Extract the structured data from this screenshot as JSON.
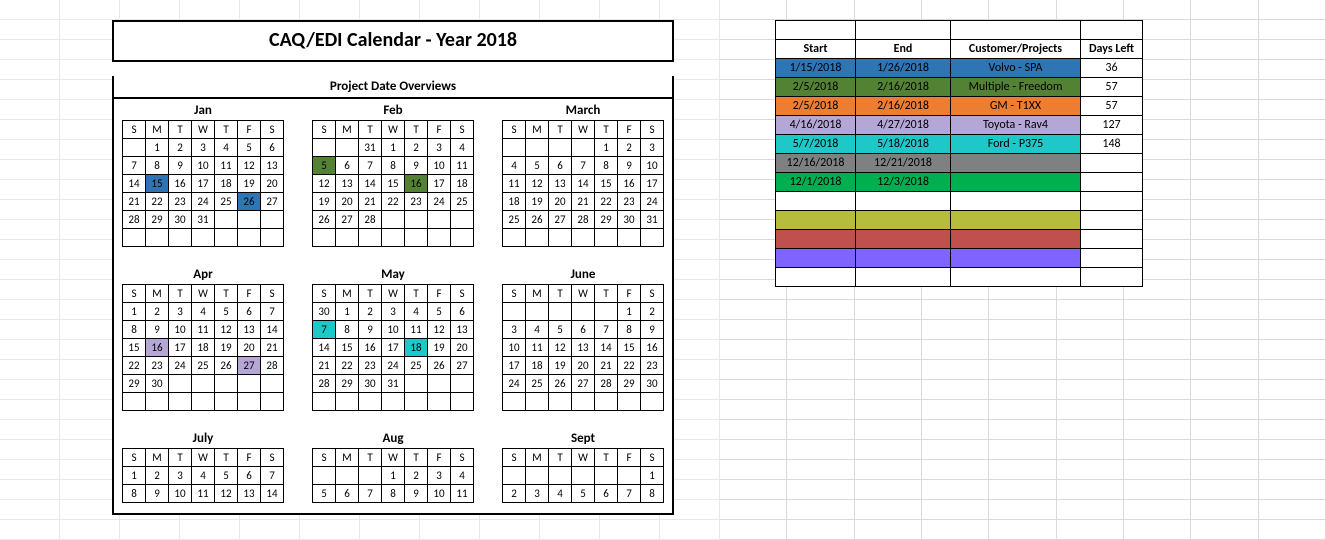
{
  "title": "CAQ/EDI Calendar - Year 2018",
  "subtitle": "Project Date Overviews",
  "dow": [
    "S",
    "M",
    "T",
    "W",
    "T",
    "F",
    "S"
  ],
  "months": [
    {
      "name": "Jan",
      "lead": 1,
      "days": 31,
      "hl": {
        "15": "#2e75b6",
        "26": "#2e75b6"
      }
    },
    {
      "name": "Feb",
      "lead": 3,
      "pre": [
        31
      ],
      "days": 28,
      "hl": {
        "5": "#548235",
        "16": "#548235"
      }
    },
    {
      "name": "March",
      "lead": 4,
      "days": 31,
      "hl": {}
    },
    {
      "name": "Apr",
      "lead": 0,
      "days": 30,
      "hl": {
        "16": "#b6a6d6",
        "27": "#b6a6d6"
      }
    },
    {
      "name": "May",
      "lead": 1,
      "pre": [
        30
      ],
      "days": 31,
      "hl": {
        "7": "#1ec8c8",
        "18": "#1ec8c8"
      }
    },
    {
      "name": "June",
      "lead": 5,
      "days": 30,
      "hl": {}
    },
    {
      "name": "July",
      "lead": 0,
      "days": 14,
      "hl": {}
    },
    {
      "name": "Aug",
      "lead": 3,
      "days": 11,
      "hl": {}
    },
    {
      "name": "Sept",
      "lead": 6,
      "days": 8,
      "hl": {}
    }
  ],
  "proj_headers": [
    "Start",
    "End",
    "Customer/Projects",
    "Days Left"
  ],
  "projects": [
    {
      "start": "1/15/2018",
      "end": "1/26/2018",
      "cust": "Volvo - SPA",
      "days": "36",
      "bg": "#2e75b6",
      "bg2": "#2e75b6",
      "bg3": "#2e75b6"
    },
    {
      "start": "2/5/2018",
      "end": "2/16/2018",
      "cust": "Multiple - Freedom",
      "days": "57",
      "bg": "#548235",
      "bg2": "#548235",
      "bg3": "#548235"
    },
    {
      "start": "2/5/2018",
      "end": "2/16/2018",
      "cust": "GM - T1XX",
      "days": "57",
      "bg": "#ed7d31",
      "bg2": "#ed7d31",
      "bg3": "#ed7d31"
    },
    {
      "start": "4/16/2018",
      "end": "4/27/2018",
      "cust": "Toyota - Rav4",
      "days": "127",
      "bg": "#b6a6d6",
      "bg2": "#b6a6d6",
      "bg3": "#b6a6d6"
    },
    {
      "start": "5/7/2018",
      "end": "5/18/2018",
      "cust": "Ford - P375",
      "days": "148",
      "bg": "#1ec8c8",
      "bg2": "#1ec8c8",
      "bg3": "#1ec8c8"
    },
    {
      "start": "12/16/2018",
      "end": "12/21/2018",
      "cust": "",
      "days": "",
      "bg": "#808080",
      "bg2": "#808080",
      "bg3": "#808080"
    },
    {
      "start": "12/1/2018",
      "end": "12/3/2018",
      "cust": "",
      "days": "",
      "bg": "#00b050",
      "bg2": "#00b050",
      "bg3": "#00b050"
    },
    {
      "start": "",
      "end": "",
      "cust": "",
      "days": "",
      "bg": "",
      "bg2": "",
      "bg3": ""
    },
    {
      "start": "",
      "end": "",
      "cust": "",
      "days": "",
      "bg": "#b5bd3b",
      "bg2": "#b5bd3b",
      "bg3": "#b5bd3b"
    },
    {
      "start": "",
      "end": "",
      "cust": "",
      "days": "",
      "bg": "#c0504d",
      "bg2": "#c0504d",
      "bg3": "#c0504d"
    },
    {
      "start": "",
      "end": "",
      "cust": "",
      "days": "",
      "bg": "#8064ff",
      "bg2": "#8064ff",
      "bg3": "#8064ff"
    },
    {
      "start": "",
      "end": "",
      "cust": "",
      "days": "",
      "bg": "",
      "bg2": "",
      "bg3": ""
    }
  ]
}
